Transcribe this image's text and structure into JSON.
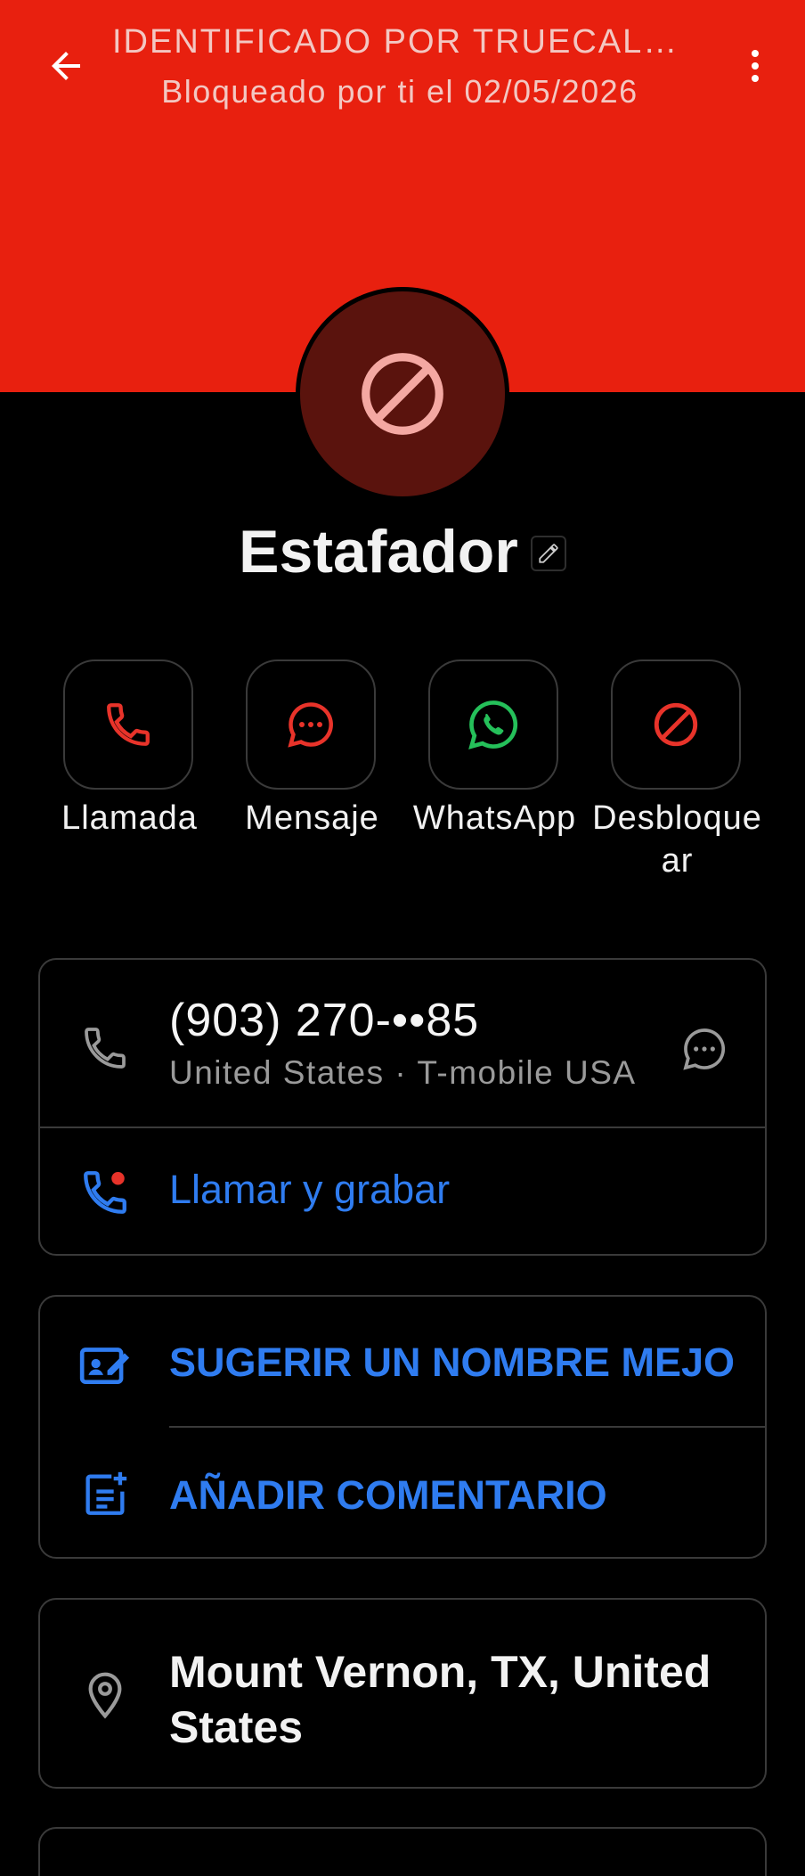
{
  "header": {
    "title": "IDENTIFICADO POR TRUECALLER",
    "subtitle": "Bloqueado por ti el 02/05/2026",
    "background_color": "#e8200f"
  },
  "contact": {
    "name": "Estafador",
    "avatar_icon": "block-icon"
  },
  "actions": [
    {
      "label": "Llamada",
      "icon": "phone-icon",
      "color": "#e8332a"
    },
    {
      "label": "Mensaje",
      "icon": "message-icon",
      "color": "#e8332a"
    },
    {
      "label": "WhatsApp",
      "icon": "whatsapp-icon",
      "color": "#25c05a"
    },
    {
      "label": "Desbloque\nar",
      "icon": "block-icon",
      "color": "#e8332a"
    }
  ],
  "phone_card": {
    "number": "(903) 270-••85",
    "details": "United States · T-mobile USA",
    "record_label": "Llamar y grabar"
  },
  "suggest_card": {
    "suggest_label": "SUGERIR UN NOMBRE MEJOR",
    "comment_label": "AÑADIR COMENTARIO"
  },
  "location": {
    "text": "Mount Vernon, TX, United States"
  },
  "colors": {
    "accent_blue": "#2f7cf0",
    "danger_red": "#e8332a",
    "whatsapp_green": "#25c05a"
  }
}
